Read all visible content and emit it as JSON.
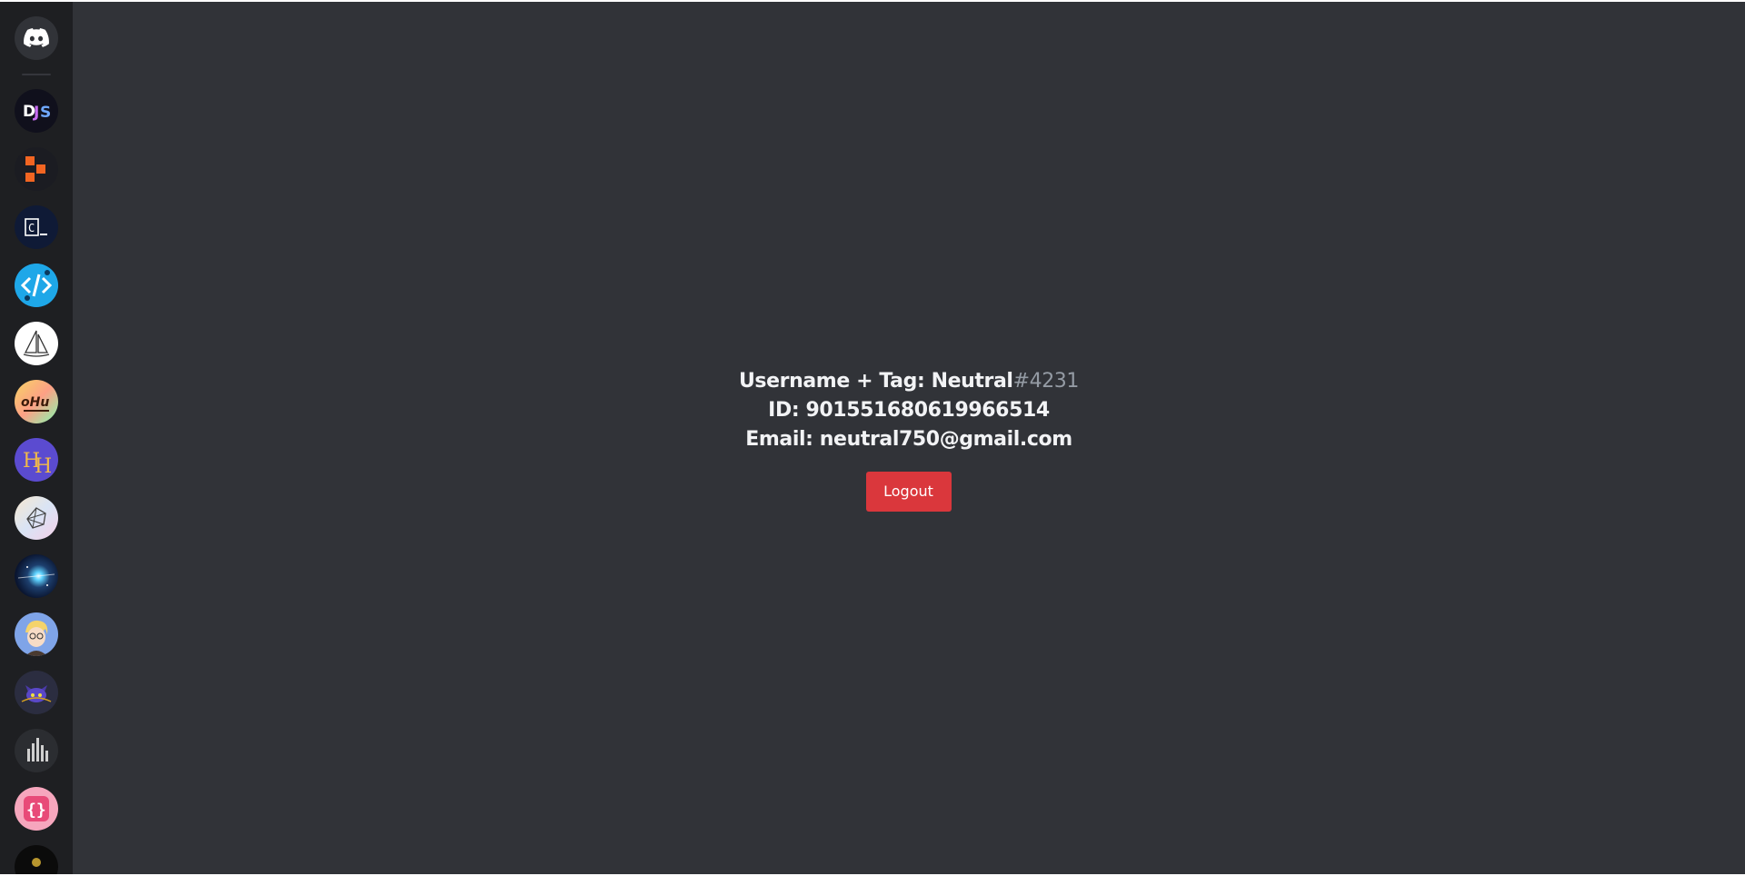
{
  "sidebar": {
    "home": {
      "icon": "discord-logo-icon"
    },
    "servers": [
      {
        "icon": "djs-server-icon",
        "text": "DJS",
        "color": "#1a1a2e"
      },
      {
        "icon": "orange-blocks-server-icon",
        "color": "#f26522"
      },
      {
        "icon": "terminal-server-icon",
        "text": "C_",
        "color": "#0d1a3a"
      },
      {
        "icon": "code-brackets-server-icon",
        "color": "#1ea7e8"
      },
      {
        "icon": "sailboat-server-icon",
        "color": "#ffffff"
      },
      {
        "icon": "colorful-logo-server-icon",
        "color": "#f5a623"
      },
      {
        "icon": "hh-server-icon",
        "color": "#6a4fd8"
      },
      {
        "icon": "geometric-server-icon",
        "color": "#e8e0f0"
      },
      {
        "icon": "space-server-icon",
        "color": "#0a1a3a"
      },
      {
        "icon": "anime-avatar-server-icon",
        "color": "#6a8cdc"
      },
      {
        "icon": "cat-face-server-icon",
        "color": "#2b2d40"
      },
      {
        "icon": "bars-server-icon",
        "color": "#2b2d31"
      },
      {
        "icon": "braces-server-icon",
        "color": "#f06292"
      },
      {
        "icon": "dark-emblem-server-icon",
        "color": "#111111"
      }
    ]
  },
  "user": {
    "username_label": "Username + Tag: Neutral",
    "tag": "#4231",
    "id_line": "ID: 901551680619966514",
    "email_line": "Email: neutral750@gmail.com"
  },
  "actions": {
    "logout_label": "Logout"
  },
  "colors": {
    "background": "#313338",
    "rail": "#1e1f22",
    "logout": "#da373c",
    "text": "#f2f3f5",
    "tag": "#949ba4"
  }
}
